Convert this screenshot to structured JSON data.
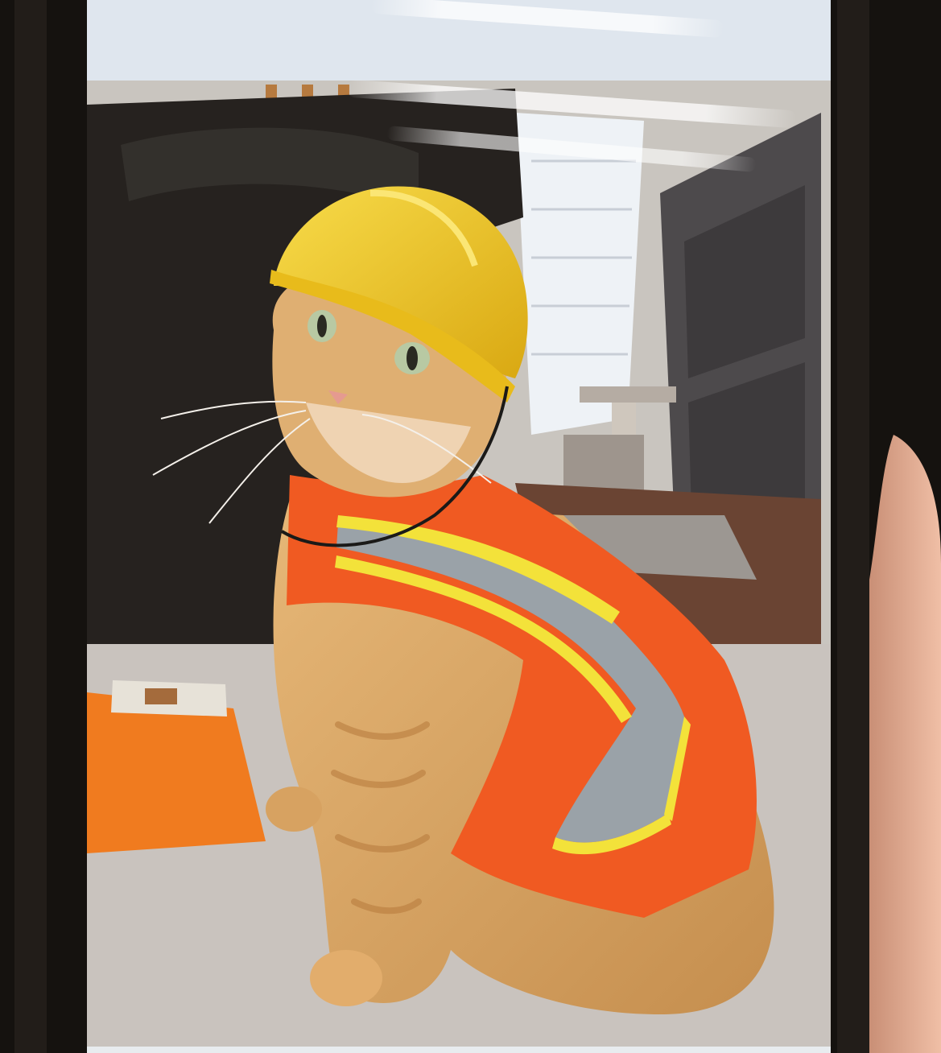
{
  "photo": {
    "subject": "orange-tabby-cat",
    "accessories": [
      "hard-hat-icon",
      "safety-vest-icon"
    ]
  },
  "colors": {
    "phone_bezel": "#15120f",
    "screen_top": "#dfe6ee",
    "wall": "#c9c5bf",
    "dark_furniture": "#26221f",
    "door": "#4d4a4c",
    "floor": "#6a4433",
    "carpet": "#cfcac5",
    "hat": "#f2c51d",
    "vest": "#f05a22",
    "reflective_stripe": "#9aa2a8",
    "yellow_trim": "#f3e23a",
    "cat_fur": "#d8a565",
    "clipboard": "#f07b1f",
    "hand": "#e9b59d"
  }
}
